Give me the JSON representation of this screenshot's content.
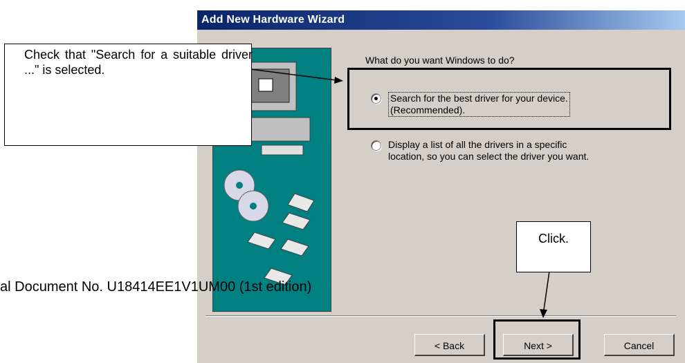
{
  "window": {
    "title": "Add New Hardware Wizard"
  },
  "wizard": {
    "prompt": "What do you want Windows to do?",
    "options": [
      {
        "label_line1": "Search for the best driver for your device.",
        "label_line2": "(Recommended).",
        "selected": true
      },
      {
        "label_line1": "Display a list of all the drivers in a specific",
        "label_line2": "location, so you can select the driver you want.",
        "selected": false
      }
    ]
  },
  "buttons": {
    "back": "< Back",
    "next": "Next >",
    "cancel": "Cancel"
  },
  "annotations": {
    "check_note": "Check that \"Search for a suitable driver ...\" is selected.",
    "click_note": "Click."
  },
  "document_text": "al Document No. U18414EE1V1UM00 (1st edition)",
  "colors": {
    "titlebar": "#0a246a",
    "dialog_bg": "#d4d0c8",
    "art_bg": "#008080"
  }
}
